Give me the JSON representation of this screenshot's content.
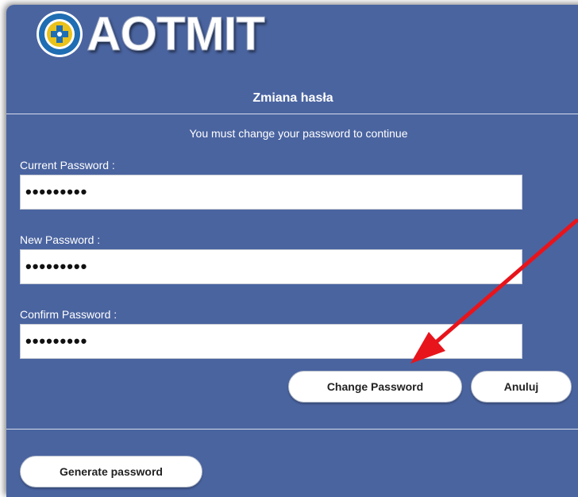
{
  "brand": {
    "name": "AOTMIT"
  },
  "form": {
    "title": "Zmiana hasła",
    "message": "You must change your password to continue",
    "fields": [
      {
        "label": "Current Password :",
        "value": "xxxxxxxxx"
      },
      {
        "label": "New Password :",
        "value": "xxxxxxxxx"
      },
      {
        "label": "Confirm Password :",
        "value": "xxxxxxxxx"
      }
    ],
    "change_button": "Change Password",
    "cancel_button": "Anuluj",
    "generate_button": "Generate password"
  },
  "colors": {
    "panel": "#4a64a0",
    "annotation_arrow": "#e8141b"
  },
  "icons": {
    "logo": "aotmit-seal-icon",
    "annotation": "red-arrow-icon"
  }
}
